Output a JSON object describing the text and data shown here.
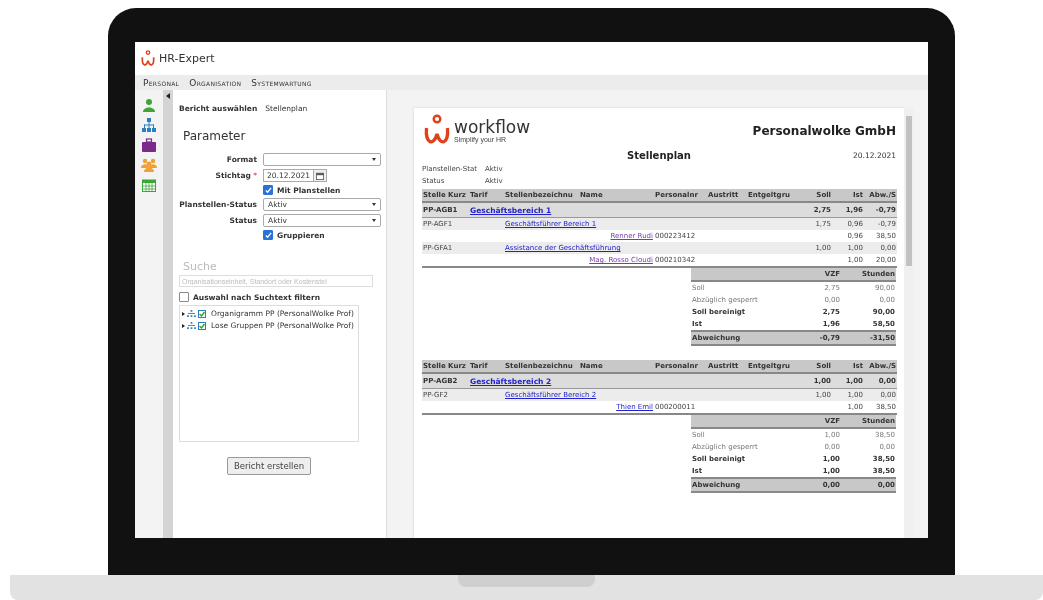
{
  "app": {
    "title": "HR-Expert"
  },
  "menu": [
    {
      "label": "Personal"
    },
    {
      "label": "Organisation"
    },
    {
      "label": "Systemwartung"
    }
  ],
  "left_panel": {
    "report_label": "Bericht auswählen",
    "report_value": "Stellenplan",
    "heading": "Parameter",
    "fields": [
      {
        "kind": "select",
        "label": "Format"
      },
      {
        "kind": "date",
        "label": "Stichtag",
        "value": "20.12.2021",
        "marker": "*"
      },
      {
        "kind": "checkbox",
        "label": "Mit Planstellen",
        "checked": true
      },
      {
        "kind": "select",
        "label": "Planstellen-Status",
        "value": "Aktiv"
      },
      {
        "kind": "select",
        "label": "Status",
        "value": "Aktiv"
      },
      {
        "kind": "checkbox",
        "label": "Gruppieren",
        "checked": true
      }
    ],
    "search": {
      "heading": "Suche",
      "placeholder": "Organisationseinheit, Standort oder Kostenstel",
      "filter_label": "Auswahl nach Suchtext filtern",
      "filter_checked": false
    },
    "tree": [
      {
        "label": "Organigramm PP (PersonalWolke Prof)",
        "expanded": false
      },
      {
        "label": "Lose Gruppen PP (PersonalWolke Prof)",
        "expanded": false
      }
    ],
    "button": "Bericht erstellen"
  },
  "report": {
    "logo_text": "workflow",
    "tagline": "Simplify your HR",
    "company": "Personalwolke GmbH",
    "title": "Stellenplan",
    "date": "20.12.2021",
    "meta": [
      {
        "label": "Planstellen-Stat",
        "value": "Aktiv"
      },
      {
        "label": "Status",
        "value": "Aktiv"
      }
    ],
    "sections": [
      {
        "columns": [
          "Stelle Kurz",
          "Tarif",
          "Stellenbezeichnu",
          "Name",
          "Personalnr",
          "Austritt",
          "Entgeltgru",
          "Soll",
          "Ist",
          "Abw./S"
        ],
        "rows": [
          {
            "kind": "group",
            "code": "PP-AGB1",
            "title": "Geschäftsbereich 1",
            "soll": "2,75",
            "ist": "1,96",
            "abw": "-0,79"
          },
          {
            "kind": "position",
            "code": "PP-AGF1",
            "title": "Geschäftsführer Bereich 1",
            "soll": "1,75",
            "ist": "0,96",
            "abw": "-0,79"
          },
          {
            "kind": "person",
            "name": "Renner Rudi",
            "visited": true,
            "number": "000223412",
            "ist": "0,96",
            "abw": "38,50"
          },
          {
            "kind": "position",
            "code": "PP-GFA1",
            "title": "Assistance der Geschäftsführung",
            "soll": "1,00",
            "ist": "1,00",
            "abw": "0,00"
          },
          {
            "kind": "person",
            "name": "Mag. Rosso Cloudi",
            "visited": true,
            "number": "000210342",
            "ist": "1,00",
            "abw": "20,00"
          }
        ],
        "summary": {
          "columns": [
            "VZF",
            "Stunden"
          ],
          "rows": [
            {
              "kind": "plain",
              "label": "Soll",
              "vzf": "2,75",
              "hours": "90,00"
            },
            {
              "kind": "plain",
              "label": "Abzüglich gesperrt",
              "vzf": "0,00",
              "hours": "0,00"
            },
            {
              "kind": "bold",
              "label": "Soll bereinigt",
              "vzf": "2,75",
              "hours": "90,00"
            },
            {
              "kind": "bold",
              "label": "Ist",
              "vzf": "1,96",
              "hours": "58,50"
            },
            {
              "kind": "total",
              "label": "Abweichung",
              "vzf": "-0,79",
              "hours": "-31,50"
            }
          ]
        }
      },
      {
        "columns": [
          "Stelle Kurz",
          "Tarif",
          "Stellenbezeichnu",
          "Name",
          "Personalnr",
          "Austritt",
          "Entgeltgru",
          "Soll",
          "Ist",
          "Abw./S"
        ],
        "rows": [
          {
            "kind": "group",
            "code": "PP-AGB2",
            "title": "Geschäftsbereich 2",
            "soll": "1,00",
            "ist": "1,00",
            "abw": "0,00"
          },
          {
            "kind": "position",
            "code": "PP-GF2",
            "title": "Geschäftsführer Bereich 2",
            "soll": "1,00",
            "ist": "1,00",
            "abw": "0,00"
          },
          {
            "kind": "person",
            "name": "Thien Emil",
            "visited": false,
            "number": "000200011",
            "ist": "1,00",
            "abw": "38,50"
          }
        ],
        "summary": {
          "columns": [
            "VZF",
            "Stunden"
          ],
          "rows": [
            {
              "kind": "plain",
              "label": "Soll",
              "vzf": "1,00",
              "hours": "38,50"
            },
            {
              "kind": "plain",
              "label": "Abzüglich gesperrt",
              "vzf": "0,00",
              "hours": "0,00"
            },
            {
              "kind": "bold",
              "label": "Soll bereinigt",
              "vzf": "1,00",
              "hours": "38,50"
            },
            {
              "kind": "bold",
              "label": "Ist",
              "vzf": "1,00",
              "hours": "38,50"
            },
            {
              "kind": "total",
              "label": "Abweichung",
              "vzf": "0,00",
              "hours": "0,00"
            }
          ]
        }
      }
    ]
  }
}
